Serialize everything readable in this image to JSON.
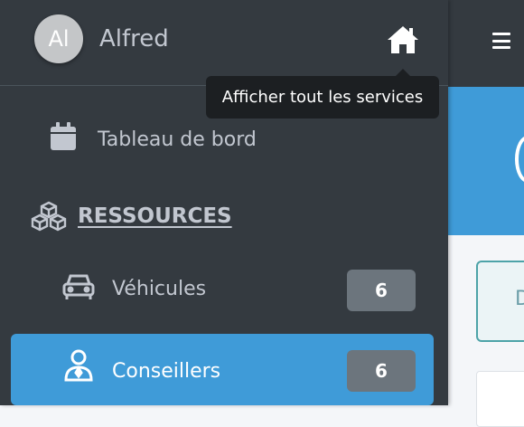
{
  "user": {
    "initials": "Al",
    "name": "Alfred"
  },
  "header": {
    "home_icon": "home-icon",
    "menu_icon": "bars-icon"
  },
  "tooltip": {
    "text": "Afficher tout les services"
  },
  "sidebar": {
    "dashboard": {
      "label": "Tableau de bord",
      "icon": "calendar-icon"
    },
    "section": {
      "label": "RESSOURCES",
      "icon": "cubes-icon"
    },
    "items": [
      {
        "label": "Véhicules",
        "count": "6",
        "icon": "car-icon",
        "active": false
      },
      {
        "label": "Conseillers",
        "count": "6",
        "icon": "user-tie-icon",
        "active": true
      }
    ]
  },
  "main": {
    "card_letter": "D"
  },
  "colors": {
    "sidebar_bg": "#343a40",
    "active_bg": "#3f9bd8",
    "badge_bg": "#6c757d",
    "tooltip_bg": "#1c1f22",
    "text": "#c2c7d0"
  }
}
